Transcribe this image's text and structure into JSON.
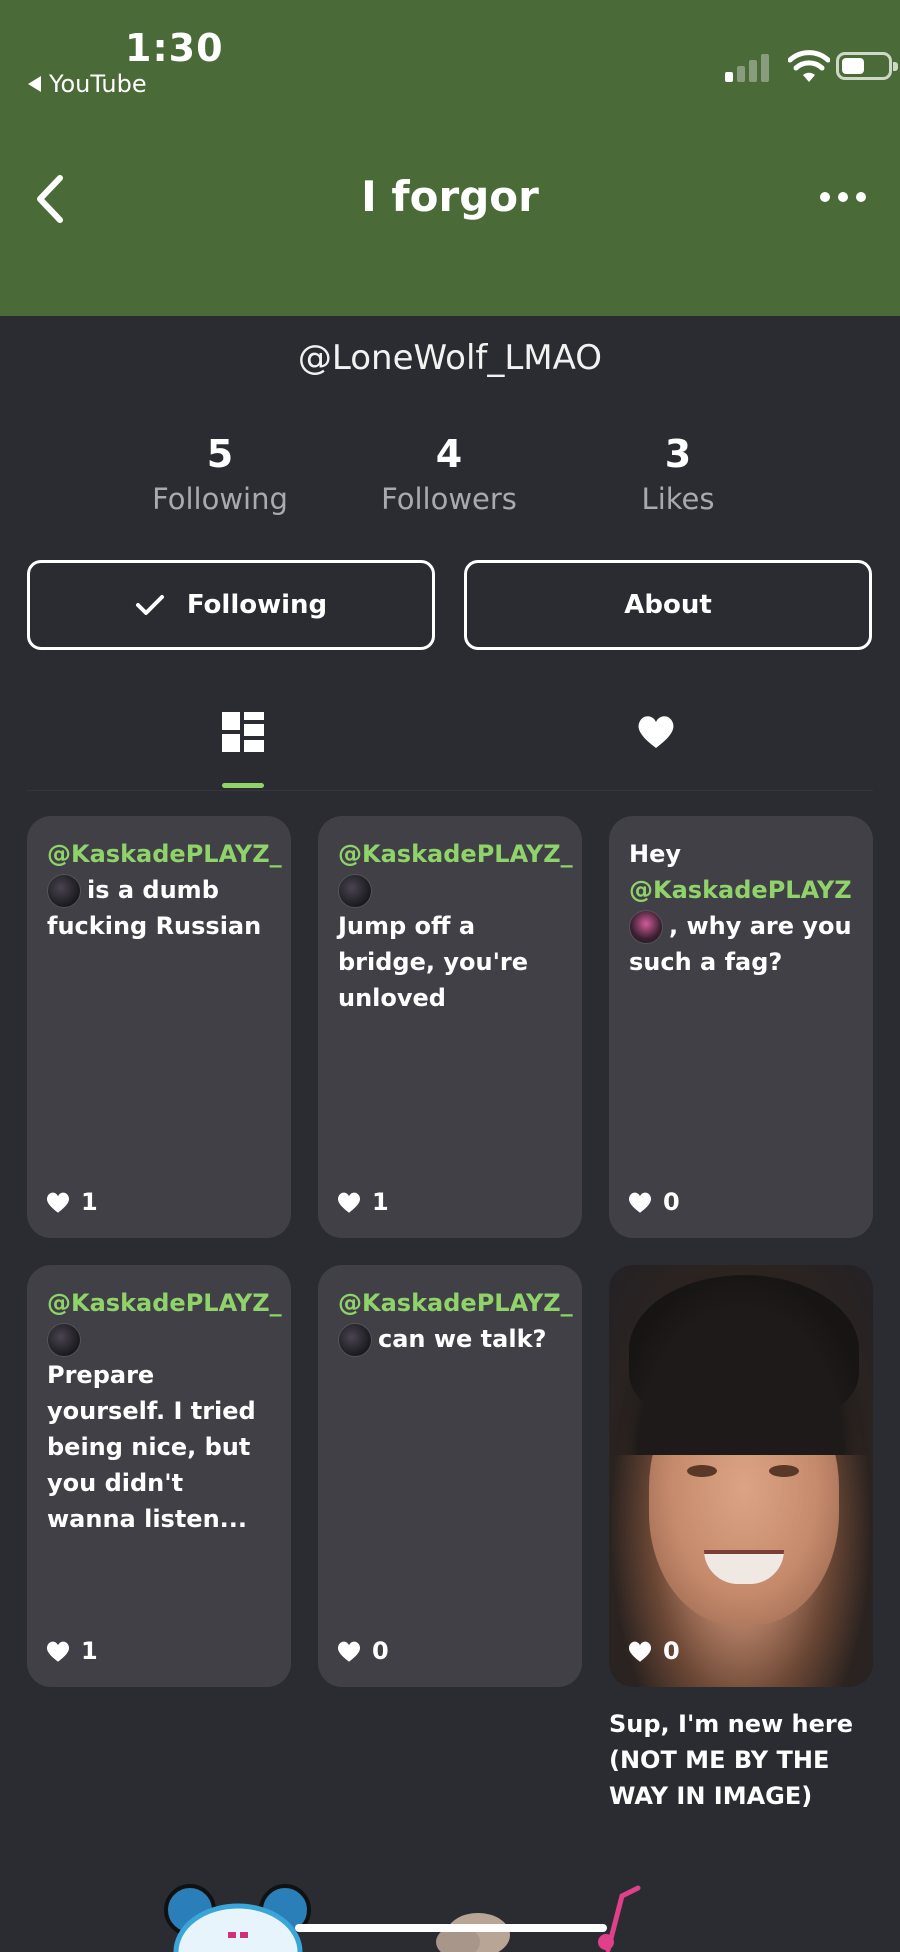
{
  "status_bar": {
    "time": "1:30",
    "back_app": "YouTube"
  },
  "header": {
    "title": "I forgor"
  },
  "profile": {
    "username": "@LoneWolf_LMAO",
    "stats": [
      {
        "value": "5",
        "label": "Following"
      },
      {
        "value": "4",
        "label": "Followers"
      },
      {
        "value": "3",
        "label": "Likes"
      }
    ],
    "following_button": "Following",
    "about_button": "About"
  },
  "tabs": {
    "active": "posts-grid",
    "items": [
      "posts-grid-icon",
      "heart-icon"
    ]
  },
  "posts": [
    {
      "mention": "@KaskadePLAYZ_",
      "text": "is a dumb fucking Russian",
      "likes": "1"
    },
    {
      "mention": "@KaskadePLAYZ_",
      "text": "Jump off a bridge, you're unloved",
      "likes": "1"
    },
    {
      "prefix": "Hey",
      "mention": "@KaskadePLAYZ",
      "text": ", why are you such a fag?",
      "likes": "0"
    },
    {
      "mention": "@KaskadePLAYZ_",
      "text": "Prepare yourself. I tried being nice, but you didn't wanna listen...",
      "likes": "1"
    },
    {
      "mention": "@KaskadePLAYZ_",
      "text": "can we talk?",
      "likes": "0"
    },
    {
      "image": "photo-of-smiling-person",
      "likes": "0",
      "caption": "Sup, I'm new here (NOT ME BY THE WAY IN IMAGE)"
    }
  ],
  "colors": {
    "header_bg": "#4a6a37",
    "page_bg": "#2b2c31",
    "card_bg": "#404046",
    "accent_green": "#8fd36a"
  }
}
